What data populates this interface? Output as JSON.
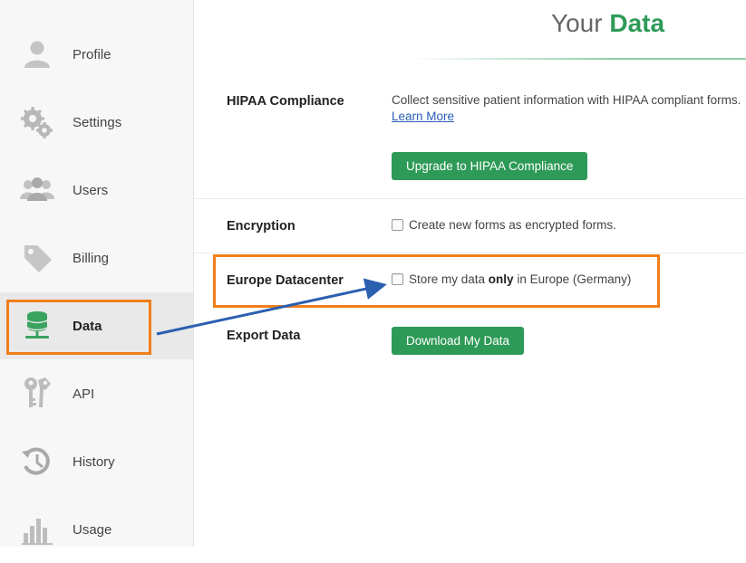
{
  "page": {
    "title_prefix": "Your",
    "title_accent": "Data"
  },
  "sidebar": {
    "items": [
      {
        "label": "Profile",
        "icon": "user-icon"
      },
      {
        "label": "Settings",
        "icon": "gears-icon"
      },
      {
        "label": "Users",
        "icon": "users-icon"
      },
      {
        "label": "Billing",
        "icon": "tag-icon"
      },
      {
        "label": "Data",
        "icon": "database-icon",
        "active": true
      },
      {
        "label": "API",
        "icon": "keys-icon"
      },
      {
        "label": "History",
        "icon": "history-icon"
      },
      {
        "label": "Usage",
        "icon": "bar-chart-icon"
      }
    ]
  },
  "sections": {
    "hipaa": {
      "label": "HIPAA Compliance",
      "description": "Collect sensitive patient information with HIPAA compliant forms.",
      "link": "Learn More",
      "button": "Upgrade to HIPAA Compliance"
    },
    "encryption": {
      "label": "Encryption",
      "checkbox_text": "Create new forms as encrypted forms."
    },
    "europe": {
      "label": "Europe Datacenter",
      "checkbox_pre": "Store my data ",
      "checkbox_bold": "only",
      "checkbox_post": " in Europe (Germany)"
    },
    "export": {
      "label": "Export Data",
      "button": "Download My Data"
    }
  },
  "colors": {
    "accent": "#2e9a57",
    "highlight": "#f07e1b",
    "arrow": "#2b5fb0",
    "link": "#2a5cb8"
  }
}
